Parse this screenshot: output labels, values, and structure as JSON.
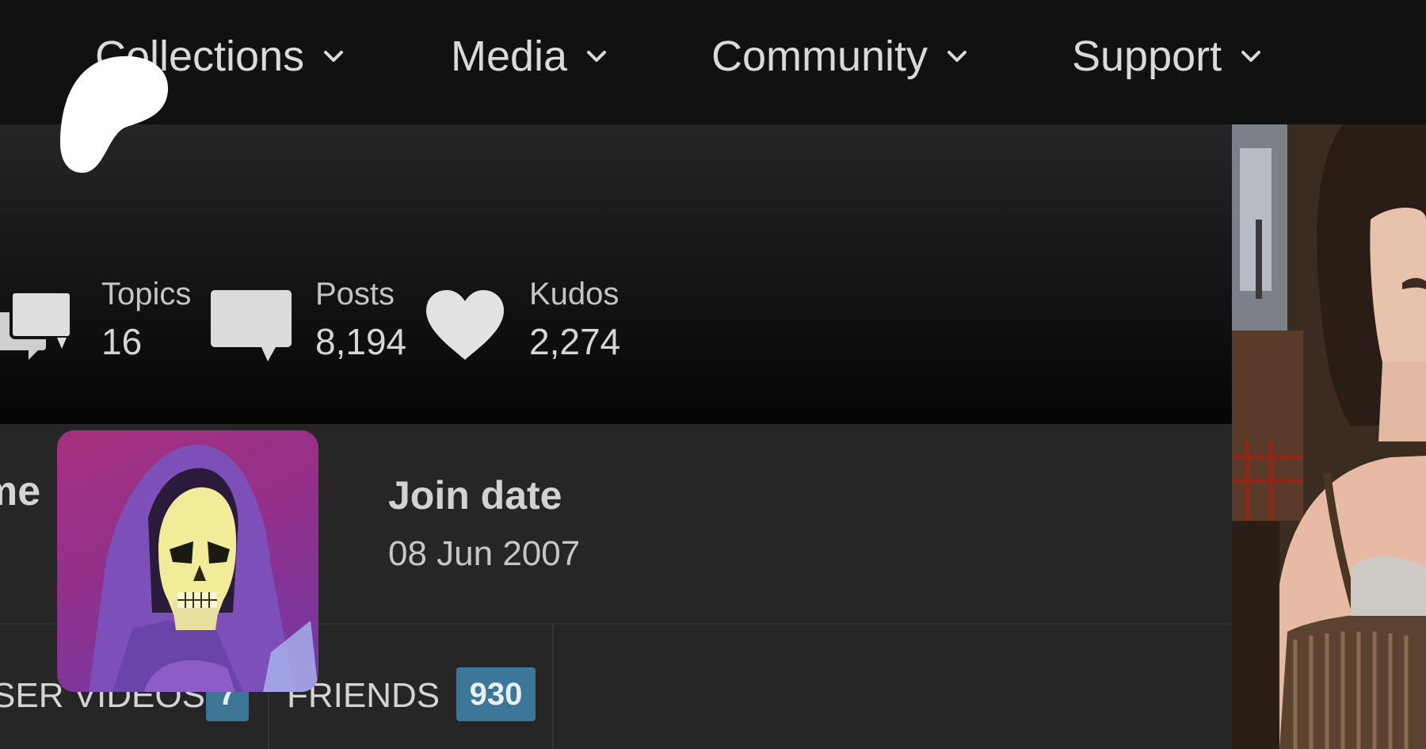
{
  "nav": {
    "items": [
      {
        "label": "Collections",
        "icon": "chevron-down-icon"
      },
      {
        "label": "Media",
        "icon": "chevron-down-icon"
      },
      {
        "label": "Community",
        "icon": "chevron-down-icon"
      },
      {
        "label": "Support",
        "icon": "chevron-down-icon"
      }
    ]
  },
  "logo": {
    "icon": "patreon-logo-icon"
  },
  "stats": {
    "topics": {
      "label": "Topics",
      "value": "16",
      "icon": "topics-speech-bubbles-icon"
    },
    "posts": {
      "label": "Posts",
      "value": "8,194",
      "icon": "posts-speech-bubble-icon"
    },
    "kudos": {
      "label": "Kudos",
      "value": "2,274",
      "icon": "heart-icon"
    }
  },
  "profile": {
    "name_label_partial": "me",
    "join_date_label": "Join date",
    "join_date_value": "08 Jun 2007"
  },
  "tabs": [
    {
      "label": "SER VIDEOS",
      "count": "7"
    },
    {
      "label": "FRIENDS",
      "count": "930"
    }
  ],
  "colors": {
    "nav_bg": "#111111",
    "page_bg": "#262626",
    "badge_bg": "#3d7797"
  }
}
